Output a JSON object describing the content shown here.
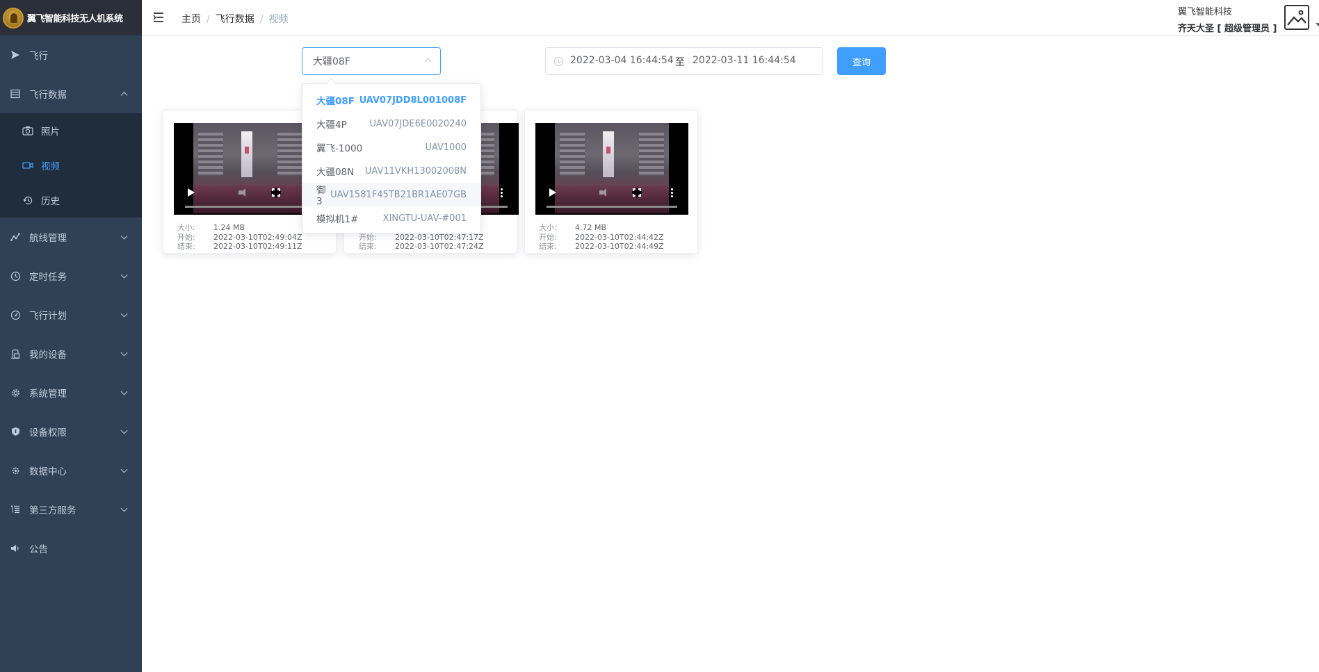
{
  "app": {
    "title": "翼飞智能科技无人机系统"
  },
  "sidebar": {
    "items": [
      {
        "label": "飞行",
        "icon": "send-icon"
      },
      {
        "label": "飞行数据",
        "icon": "list-icon",
        "expanded": true,
        "children": [
          {
            "label": "照片",
            "icon": "camera-icon"
          },
          {
            "label": "视频",
            "icon": "video-icon",
            "active": true
          },
          {
            "label": "历史",
            "icon": "history-icon"
          }
        ]
      },
      {
        "label": "航线管理",
        "icon": "route-icon"
      },
      {
        "label": "定时任务",
        "icon": "clock-icon"
      },
      {
        "label": "飞行计划",
        "icon": "gauge-icon"
      },
      {
        "label": "我的设备",
        "icon": "device-icon"
      },
      {
        "label": "系统管理",
        "icon": "gear-icon"
      },
      {
        "label": "设备权限",
        "icon": "shield-icon"
      },
      {
        "label": "数据中心",
        "icon": "cog-small-icon"
      },
      {
        "label": "第三方服务",
        "icon": "tree-list-icon"
      },
      {
        "label": "公告",
        "icon": "speaker-icon"
      }
    ]
  },
  "header": {
    "breadcrumb": [
      "主页",
      "飞行数据",
      "视频"
    ],
    "company": "翼飞智能科技",
    "user": "齐天大圣 [ 超级管理员 ]"
  },
  "filters": {
    "device_select": "大疆08F",
    "date_start": "2022-03-04 16:44:54",
    "date_to": "至",
    "date_end": "2022-03-11 16:44:54",
    "query_label": "查询"
  },
  "dropdown": {
    "options": [
      {
        "name": "大疆08F",
        "code": "UAV07JDD8L001008F",
        "selected": true
      },
      {
        "name": "大疆4P",
        "code": "UAV07JDE6E0020240"
      },
      {
        "name": "翼飞-1000",
        "code": "UAV1000"
      },
      {
        "name": "大疆08N",
        "code": "UAV11VKH13002008N"
      },
      {
        "name": "御3",
        "code": "UAV1581F45TB21BR1AE07GB",
        "hover": true
      },
      {
        "name": "模拟机1#",
        "code": "XINGTU-UAV-#001"
      }
    ]
  },
  "videos": {
    "labels": {
      "size": "大小:",
      "start": "开始:",
      "end": "结束:"
    },
    "items": [
      {
        "size": "1.24 MB",
        "start": "2022-03-10T02:49:04Z",
        "end": "2022-03-10T02:49:11Z"
      },
      {
        "size": "",
        "start": "2022-03-10T02:47:17Z",
        "end": "2022-03-10T02:47:24Z"
      },
      {
        "size": "4.72 MB",
        "start": "2022-03-10T02:44:42Z",
        "end": "2022-03-10T02:44:49Z"
      }
    ]
  },
  "colors": {
    "sidebar_bg": "#304156",
    "submenu_bg": "#1f2d3d",
    "accent": "#409eff"
  }
}
